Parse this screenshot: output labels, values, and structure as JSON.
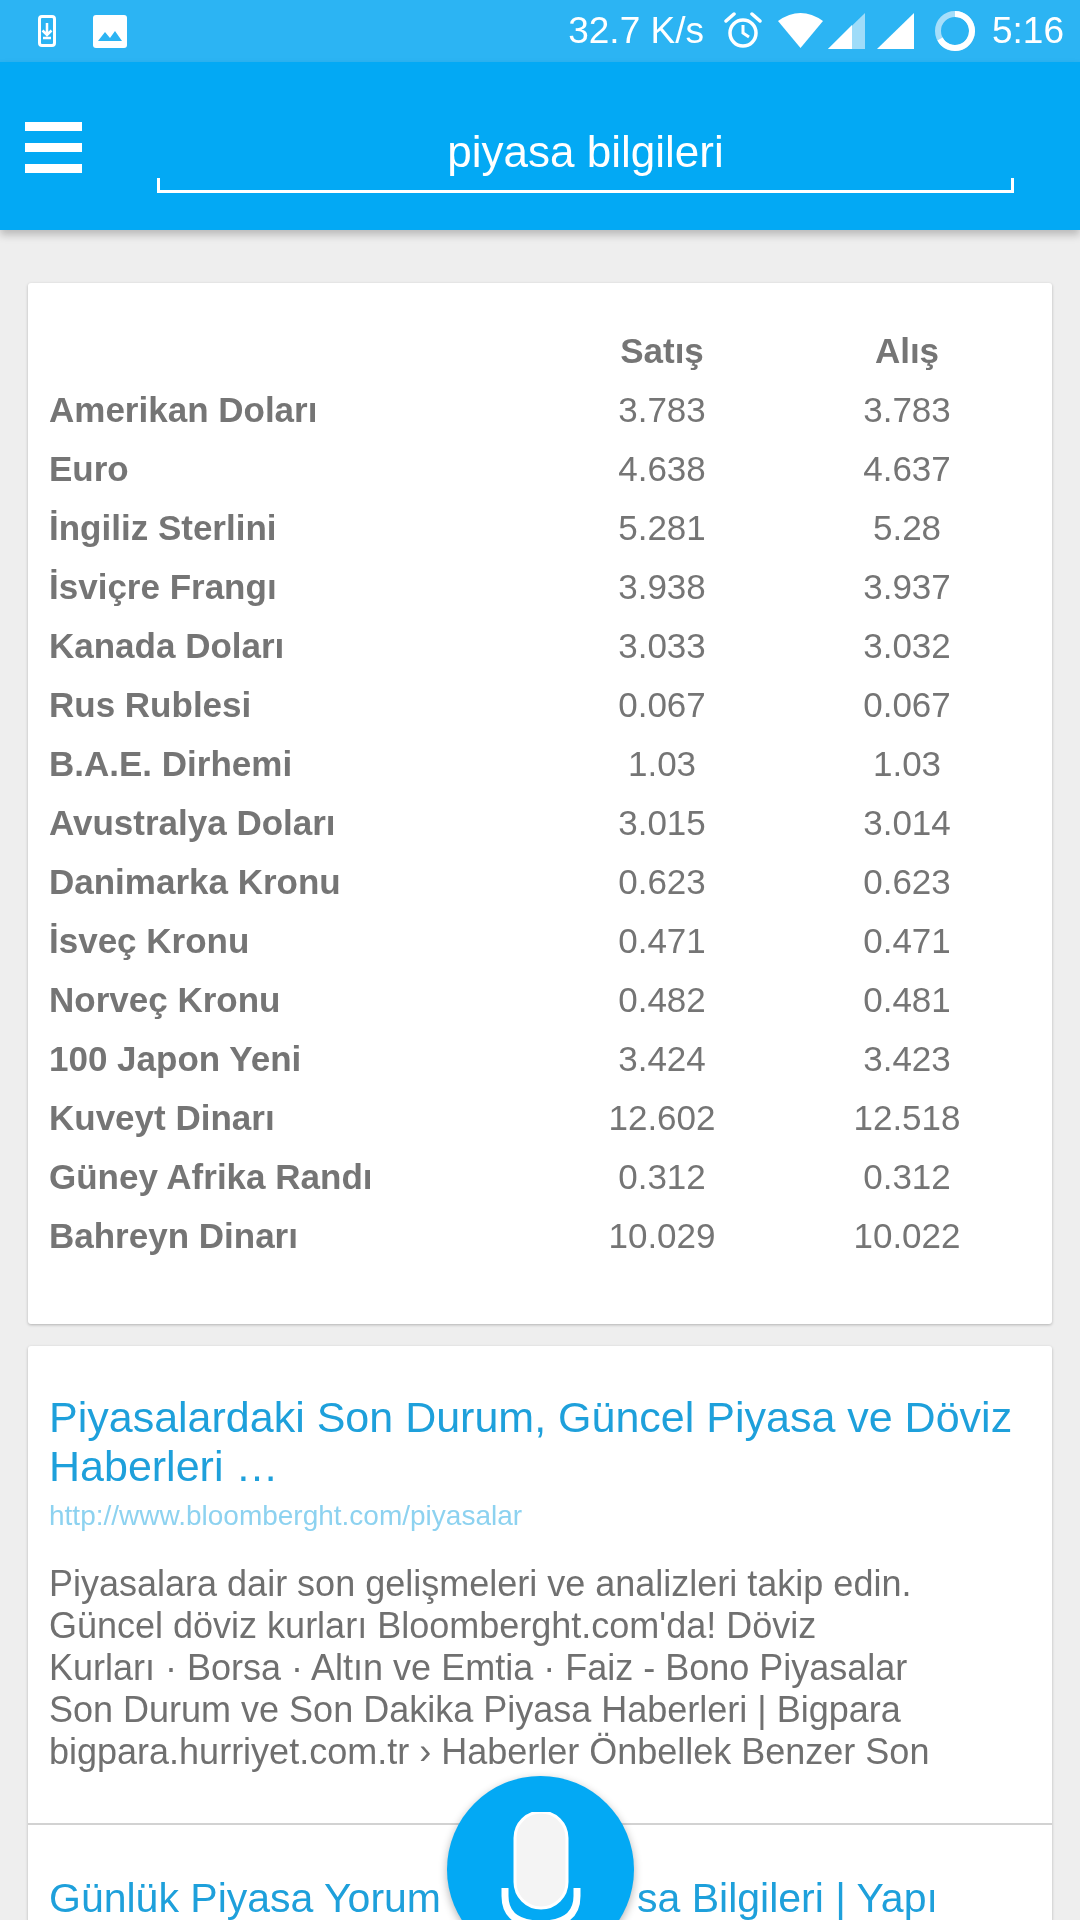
{
  "status_bar": {
    "network_speed": "32.7 K/s",
    "time": "5:16"
  },
  "app_bar": {
    "search": {
      "value": "piyasa bilgileri"
    }
  },
  "rates": {
    "columns": [
      "Satış",
      "Alış"
    ],
    "rows": [
      {
        "currency": "Amerikan Doları",
        "sell": "3.783",
        "buy": "3.783"
      },
      {
        "currency": "Euro",
        "sell": "4.638",
        "buy": "4.637"
      },
      {
        "currency": "İngiliz Sterlini",
        "sell": "5.281",
        "buy": "5.28"
      },
      {
        "currency": "İsviçre Frangı",
        "sell": "3.938",
        "buy": "3.937"
      },
      {
        "currency": "Kanada Doları",
        "sell": "3.033",
        "buy": "3.032"
      },
      {
        "currency": "Rus Rublesi",
        "sell": "0.067",
        "buy": "0.067"
      },
      {
        "currency": "B.A.E. Dirhemi",
        "sell": "1.03",
        "buy": "1.03"
      },
      {
        "currency": "Avustralya Doları",
        "sell": "3.015",
        "buy": "3.014"
      },
      {
        "currency": "Danimarka Kronu",
        "sell": "0.623",
        "buy": "0.623"
      },
      {
        "currency": "İsveç Kronu",
        "sell": "0.471",
        "buy": "0.471"
      },
      {
        "currency": "Norveç Kronu",
        "sell": "0.482",
        "buy": "0.481"
      },
      {
        "currency": "100 Japon Yeni",
        "sell": "3.424",
        "buy": "3.423"
      },
      {
        "currency": "Kuveyt Dinarı",
        "sell": "12.602",
        "buy": "12.518"
      },
      {
        "currency": "Güney Afrika Randı",
        "sell": "0.312",
        "buy": "0.312"
      },
      {
        "currency": "Bahreyn Dinarı",
        "sell": "10.029",
        "buy": "10.022"
      }
    ]
  },
  "results": [
    {
      "title": "Piyasalardaki Son Durum, Güncel Piyasa ve Döviz Haberleri …",
      "url": "http://www.bloomberght.com/piyasalar",
      "snippet": "Piyasalara dair son gelişmeleri ve analizleri takip edin.\nGüncel döviz kurları Bloomberght.com'da! Döviz\nKurları · Borsa · Altın ve Emtia · Faiz - Bono Piyasalar\nSon Durum ve Son Dakika Piyasa Haberleri | Bigpara\nbigpara.hurriyet.com.tr › Haberler Önbellek Benzer Son"
    }
  ],
  "next_result": {
    "title_parts": [
      "Günlük Piyasa Yorum",
      "sa Bilgileri | Yapı"
    ]
  }
}
